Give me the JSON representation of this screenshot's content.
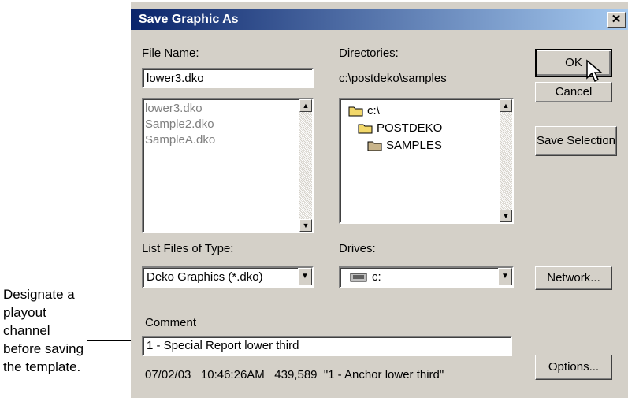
{
  "callout": {
    "lines": [
      "Designate a",
      "playout",
      "channel",
      "before saving",
      "the template."
    ]
  },
  "dialog": {
    "title": "Save Graphic As",
    "close_glyph": "✕",
    "file_name": {
      "label": "File Name:",
      "value": "lower3.dko",
      "files": [
        "lower3.dko",
        "Sample2.dko",
        "SampleA.dko"
      ]
    },
    "directories": {
      "label": "Directories:",
      "path": "c:\\postdeko\\samples",
      "items": [
        "c:\\",
        "POSTDEKO",
        "SAMPLES"
      ]
    },
    "buttons": {
      "ok": "OK",
      "cancel": "Cancel",
      "save_selection": "Save Selection",
      "network": "Network...",
      "options": "Options..."
    },
    "list_type": {
      "label": "List Files of Type:",
      "value": "Deko Graphics (*.dko)"
    },
    "drives": {
      "label": "Drives:",
      "value": "c:"
    },
    "comment": {
      "label": "Comment",
      "value": "1 - Special Report lower third"
    },
    "status_line": "07/02/03   10:46:26AM   439,589  \"1 - Anchor lower third\""
  },
  "colors": {
    "title_start": "#0a246a",
    "title_end": "#a6caf0",
    "dialog_bg": "#d4d0c8",
    "folder": "#f2d86b"
  },
  "icons": {
    "folder": "folder-icon",
    "drive": "hard-drive-icon",
    "cursor": "mouse-pointer-icon"
  }
}
